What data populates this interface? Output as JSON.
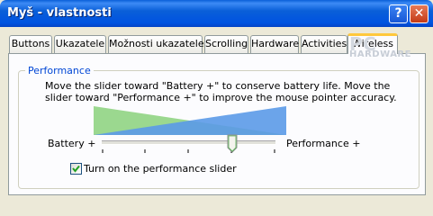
{
  "window": {
    "title": "Myš - vlastnosti",
    "help_glyph": "?",
    "close_glyph": "✕"
  },
  "tabs": [
    {
      "label": "Buttons"
    },
    {
      "label": "Ukazatele"
    },
    {
      "label": "Možnosti ukazatele"
    },
    {
      "label": "Scrolling"
    },
    {
      "label": "Hardware"
    },
    {
      "label": "Activities"
    },
    {
      "label": "Wireless",
      "active": true
    }
  ],
  "performance": {
    "group_label": "Performance",
    "description_line1": "Move the slider toward \"Battery +\" to conserve battery life. Move the",
    "description_line2": "slider toward \"Performance +\" to improve the mouse pointer accuracy.",
    "left_label": "Battery +",
    "right_label": "Performance +",
    "slider_value_fraction": 0.75,
    "checkbox_label": "Turn on the performance slider",
    "checkbox_checked": true,
    "battery_color": "#9BD88F",
    "performance_color": "#5B9AE8"
  },
  "watermark": {
    "line1": "PC",
    "line2": "HARDWARE"
  }
}
